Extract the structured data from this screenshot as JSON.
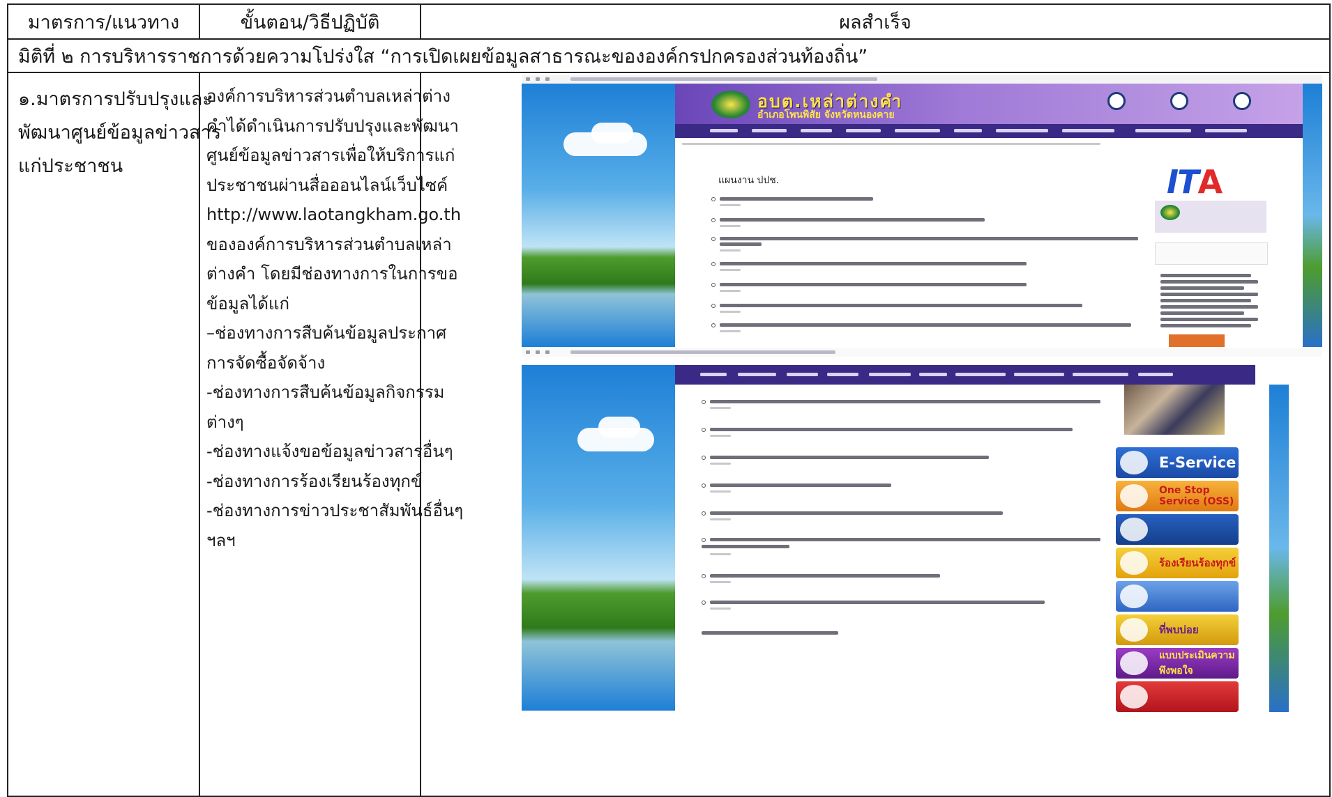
{
  "table": {
    "headers": [
      "มาตรการ/แนวทาง",
      "ขั้นตอน/วิธีปฏิบัติ",
      "ผลสำเร็จ"
    ],
    "dimension": "มิติที่ ๒ การบริหารราชการด้วยความโปร่งใส “การเปิดเผยข้อมูลสาธารณะขององค์กรปกครองส่วนท้องถิ่น”",
    "measure_lines": [
      "๑.มาตรการปรับปรุงและ",
      "พัฒนาศูนย์ข้อมูลข่าวสาร",
      "แก่ประชาชน"
    ],
    "procedure_lines": [
      "องค์การบริหารส่วนตำบลเหล่าต่าง",
      "คำได้ดำเนินการปรับปรุงและพัฒนา",
      "ศูนย์ข้อมูลข่าวสารเพื่อให้บริการแก่",
      "ประชาชนผ่านสื่อออนไลน์เว็บไซค์",
      "http://www.laotangkham.go.th",
      "ขององค์การบริหารส่วนตำบลเหล่า",
      "ต่างคำ โดยมีช่องทางการในการขอ",
      "ข้อมูลได้แก่",
      "–ช่องทางการสืบค้นข้อมูลประกาศ",
      "การจัดซื้อจัดจ้าง",
      "-ช่องทางการสืบค้นข้อมูลกิจกรรม",
      "ต่างๆ",
      "-ช่องทางแจ้งขอข้อมูลข่าวสารอื่นๆ",
      "-ช่องทางการร้องเรียนร้องทุกข์",
      "-ช่องทางการข่าวประชาสัมพันธ์อื่นๆ",
      "ฯลฯ"
    ]
  },
  "screenshot1": {
    "site_title": "อบต.เหล่าต่างคำ",
    "site_subtitle": "อำเภอโพนพิสัย จังหวัดหนองคาย",
    "section_heading": "แผนงาน ปปช.",
    "logo_text": "ITA"
  },
  "screenshot2": {
    "side_buttons": [
      {
        "label": "E-Service",
        "color": "#1f56b8"
      },
      {
        "label": "One Stop Service (OSS)",
        "color": "#f08a1c"
      },
      {
        "label": "",
        "color": "#1b4fa6"
      },
      {
        "label": "ร้องเรียนร้องทุกข์",
        "color": "#e8a20f"
      },
      {
        "label": "",
        "color": "#3a77c9"
      },
      {
        "label": "ที่พบบ่อย",
        "color": "#d8a40f"
      },
      {
        "label": "แบบประเมินความพึงพอใจ",
        "color": "#7a2aa0"
      },
      {
        "label": "",
        "color": "#d3202a"
      }
    ]
  },
  "colors": {
    "banner_purple": "#6b46b8",
    "navbar": "#3a2a86",
    "border": "#222222"
  }
}
